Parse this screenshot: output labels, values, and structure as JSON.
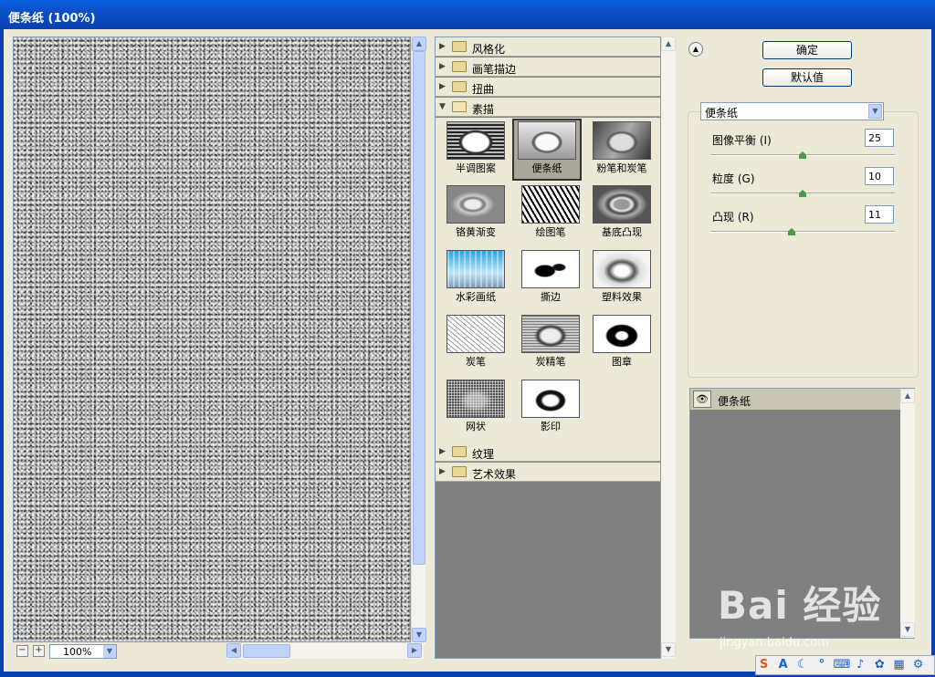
{
  "window": {
    "title": "便条纸 (100%)"
  },
  "preview": {
    "zoom_value": "100%"
  },
  "filter_folders_top": [
    {
      "label": "风格化"
    },
    {
      "label": "画笔描边"
    },
    {
      "label": "扭曲"
    },
    {
      "label": "素描"
    }
  ],
  "sketch_filters": [
    {
      "label": "半调图案",
      "icon": "halftone-pattern-thumb"
    },
    {
      "label": "便条纸",
      "icon": "note-paper-thumb",
      "selected": true
    },
    {
      "label": "粉笔和炭笔",
      "icon": "chalk-charcoal-thumb"
    },
    {
      "label": "铬黄渐变",
      "icon": "chrome-thumb"
    },
    {
      "label": "绘图笔",
      "icon": "graphic-pen-thumb"
    },
    {
      "label": "基底凸现",
      "icon": "bas-relief-thumb"
    },
    {
      "label": "水彩画纸",
      "icon": "water-paper-thumb"
    },
    {
      "label": "撕边",
      "icon": "torn-edges-thumb"
    },
    {
      "label": "塑料效果",
      "icon": "plaster-thumb"
    },
    {
      "label": "炭笔",
      "icon": "charcoal-thumb"
    },
    {
      "label": "炭精笔",
      "icon": "conte-crayon-thumb"
    },
    {
      "label": "图章",
      "icon": "stamp-thumb"
    },
    {
      "label": "网状",
      "icon": "reticulation-thumb"
    },
    {
      "label": "影印",
      "icon": "photocopy-thumb"
    }
  ],
  "filter_folders_bottom": [
    {
      "label": "纹理"
    },
    {
      "label": "艺术效果"
    }
  ],
  "buttons": {
    "ok": "确定",
    "default": "默认值"
  },
  "filter_select": {
    "value": "便条纸"
  },
  "params": [
    {
      "label": "图像平衡",
      "key": "(I)",
      "value": "25",
      "level": 0.5
    },
    {
      "label": "粒度",
      "key": "(G)",
      "value": "10",
      "level": 0.5
    },
    {
      "label": "凸现",
      "key": "(R)",
      "value": "11",
      "level": 0.44
    }
  ],
  "layers": [
    {
      "name": "便条纸"
    }
  ],
  "watermark": {
    "brand": "Bai 经验",
    "url": "jingyan.baidu.com"
  }
}
